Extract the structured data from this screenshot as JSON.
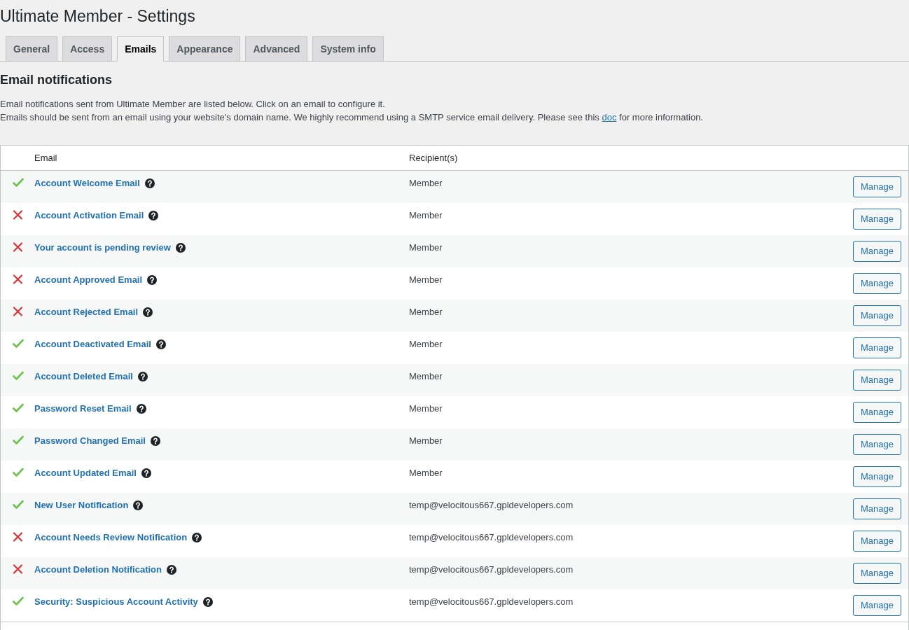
{
  "page_title": "Ultimate Member - Settings",
  "tabs": [
    {
      "label": "General",
      "selected": false
    },
    {
      "label": "Access",
      "selected": false
    },
    {
      "label": "Emails",
      "selected": true
    },
    {
      "label": "Appearance",
      "selected": false
    },
    {
      "label": "Advanced",
      "selected": false
    },
    {
      "label": "System info",
      "selected": false
    }
  ],
  "section": {
    "heading": "Email notifications",
    "intro": "Email notifications sent from Ultimate Member are listed below. Click on an email to configure it.",
    "advice": {
      "before_link": "Emails should be sent from an email using your website's domain name. We highly recommend using a SMTP service email delivery. Please see this",
      "link": "doc",
      "after_link": "for more information."
    }
  },
  "table": {
    "columns": [
      "Email",
      "Recipient(s)"
    ],
    "rows": [
      {
        "enabled": true,
        "name": "Account Welcome Email",
        "recipient": "Member",
        "action": "Manage"
      },
      {
        "enabled": false,
        "name": "Account Activation Email",
        "recipient": "Member",
        "action": "Manage"
      },
      {
        "enabled": false,
        "name": "Your account is pending review",
        "recipient": "Member",
        "action": "Manage"
      },
      {
        "enabled": false,
        "name": "Account Approved Email",
        "recipient": "Member",
        "action": "Manage"
      },
      {
        "enabled": false,
        "name": "Account Rejected Email",
        "recipient": "Member",
        "action": "Manage"
      },
      {
        "enabled": true,
        "name": "Account Deactivated Email",
        "recipient": "Member",
        "action": "Manage"
      },
      {
        "enabled": true,
        "name": "Account Deleted Email",
        "recipient": "Member",
        "action": "Manage"
      },
      {
        "enabled": true,
        "name": "Password Reset Email",
        "recipient": "Member",
        "action": "Manage"
      },
      {
        "enabled": true,
        "name": "Password Changed Email",
        "recipient": "Member",
        "action": "Manage"
      },
      {
        "enabled": true,
        "name": "Account Updated Email",
        "recipient": "Member",
        "action": "Manage"
      },
      {
        "enabled": true,
        "name": "New User Notification",
        "recipient": "temp@velocitous667.gpldevelopers.com",
        "action": "Manage"
      },
      {
        "enabled": false,
        "name": "Account Needs Review Notification",
        "recipient": "temp@velocitous667.gpldevelopers.com",
        "action": "Manage"
      },
      {
        "enabled": false,
        "name": "Account Deletion Notification",
        "recipient": "temp@velocitous667.gpldevelopers.com",
        "action": "Manage"
      },
      {
        "enabled": true,
        "name": "Security: Suspicious Account Activity",
        "recipient": "temp@velocitous667.gpldevelopers.com",
        "action": "Manage"
      }
    ]
  }
}
